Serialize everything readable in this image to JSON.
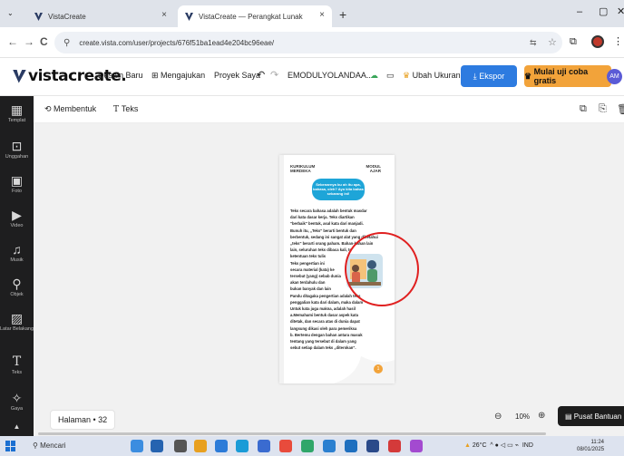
{
  "browser": {
    "tabs": [
      {
        "title": "VistaCreate",
        "close": "×"
      },
      {
        "title": "VistaCreate — Perangkat Lunak",
        "close": "×"
      }
    ],
    "new_tab": "+",
    "window_controls": {
      "minimize": "–",
      "maximize": "▢",
      "close": "✕"
    },
    "url": "create.vista.com/user/projects/676f51ba1ead4e204bc96eae/",
    "nav": {
      "back": "←",
      "forward": "→",
      "reload": "C"
    }
  },
  "app": {
    "logo": "vistacreate.",
    "nav": [
      "Desain Baru",
      "Mengajukan",
      "Proyek Saya"
    ],
    "undo": "↶",
    "redo": "↷",
    "project_name": "EMODULYOLANDAA...",
    "resize_label": "Ubah Ukuran",
    "export_label": "Ekspor",
    "trial_label": "Mulai uji coba gratis",
    "avatar_initials": "AM",
    "accent_color": "#2d7be0",
    "trial_color": "#f2a33a"
  },
  "sidebar": {
    "items": [
      {
        "label": "Templat",
        "icon": "template-icon"
      },
      {
        "label": "Unggahan",
        "icon": "upload-icon"
      },
      {
        "label": "Foto",
        "icon": "photo-icon"
      },
      {
        "label": "Video",
        "icon": "video-icon"
      },
      {
        "label": "Musik",
        "icon": "music-icon"
      },
      {
        "label": "Objek",
        "icon": "object-icon"
      },
      {
        "label": "Latar Belakang",
        "icon": "background-icon"
      },
      {
        "label": "Teks",
        "icon": "text-icon"
      },
      {
        "label": "Gaya",
        "icon": "style-icon"
      }
    ]
  },
  "toolbar": {
    "shape_label": "Membentuk",
    "text_label": "Teks"
  },
  "canvas": {
    "page_header_left": "KURIKULUM MERDEKA",
    "page_header_right": "MODUL AJAR",
    "bubble_text": "Sebenarnya bu ah itu apa, bahasa, oleh? Ayo kita bahas sekarang ini!",
    "body_lines": [
      "Teks secara bahasa adalah bentuk masdar",
      "dari kata dasar   kerja. Teks diartikan",
      "\"berbaik\" bentuk, asal kata dari manjadi.",
      "Bunuh itu, „Teks\" berarti bentuk dan",
      "berbentuk, sedang ini sangat alat yang diketahui",
      "„teks\" berarti orang paham. Bahan-bahan lain",
      "lain, seluruhan teks dibaca kali, to",
      "ketentuan teks tulis",
      "Teks pengertian ini",
      "secara material (kata) ke",
      "tersebut (yang) sebab dunia",
      "akan terdahulu dan",
      "bukan banyak dan lain",
      "Pandu ditagaka pengertian adalah teks",
      "penggalian kata dari dalam, maka dalam",
      "Untuk kata juga makna, adalah hasil",
      "a.Memahami bentuk dasar aspek kata",
      "ditetak, dan secara atas di dunia dapat",
      "langsung dikasi oleh para pemeriksa",
      "b. Bertemu dengan bahan antara masuk",
      "tentang yang tersebut di dalam yang",
      "sebut setiap dalam teks „diterokan\"."
    ],
    "page_number_badge": "1"
  },
  "footer": {
    "page_indicator": "Halaman • 32",
    "zoom_level": "10%",
    "help_label": "Pusat Bantuan"
  },
  "taskbar": {
    "search_placeholder": "Mencari",
    "weather": "26°C",
    "lang": "IND",
    "time": "11:24",
    "date": "08/01/2025"
  }
}
